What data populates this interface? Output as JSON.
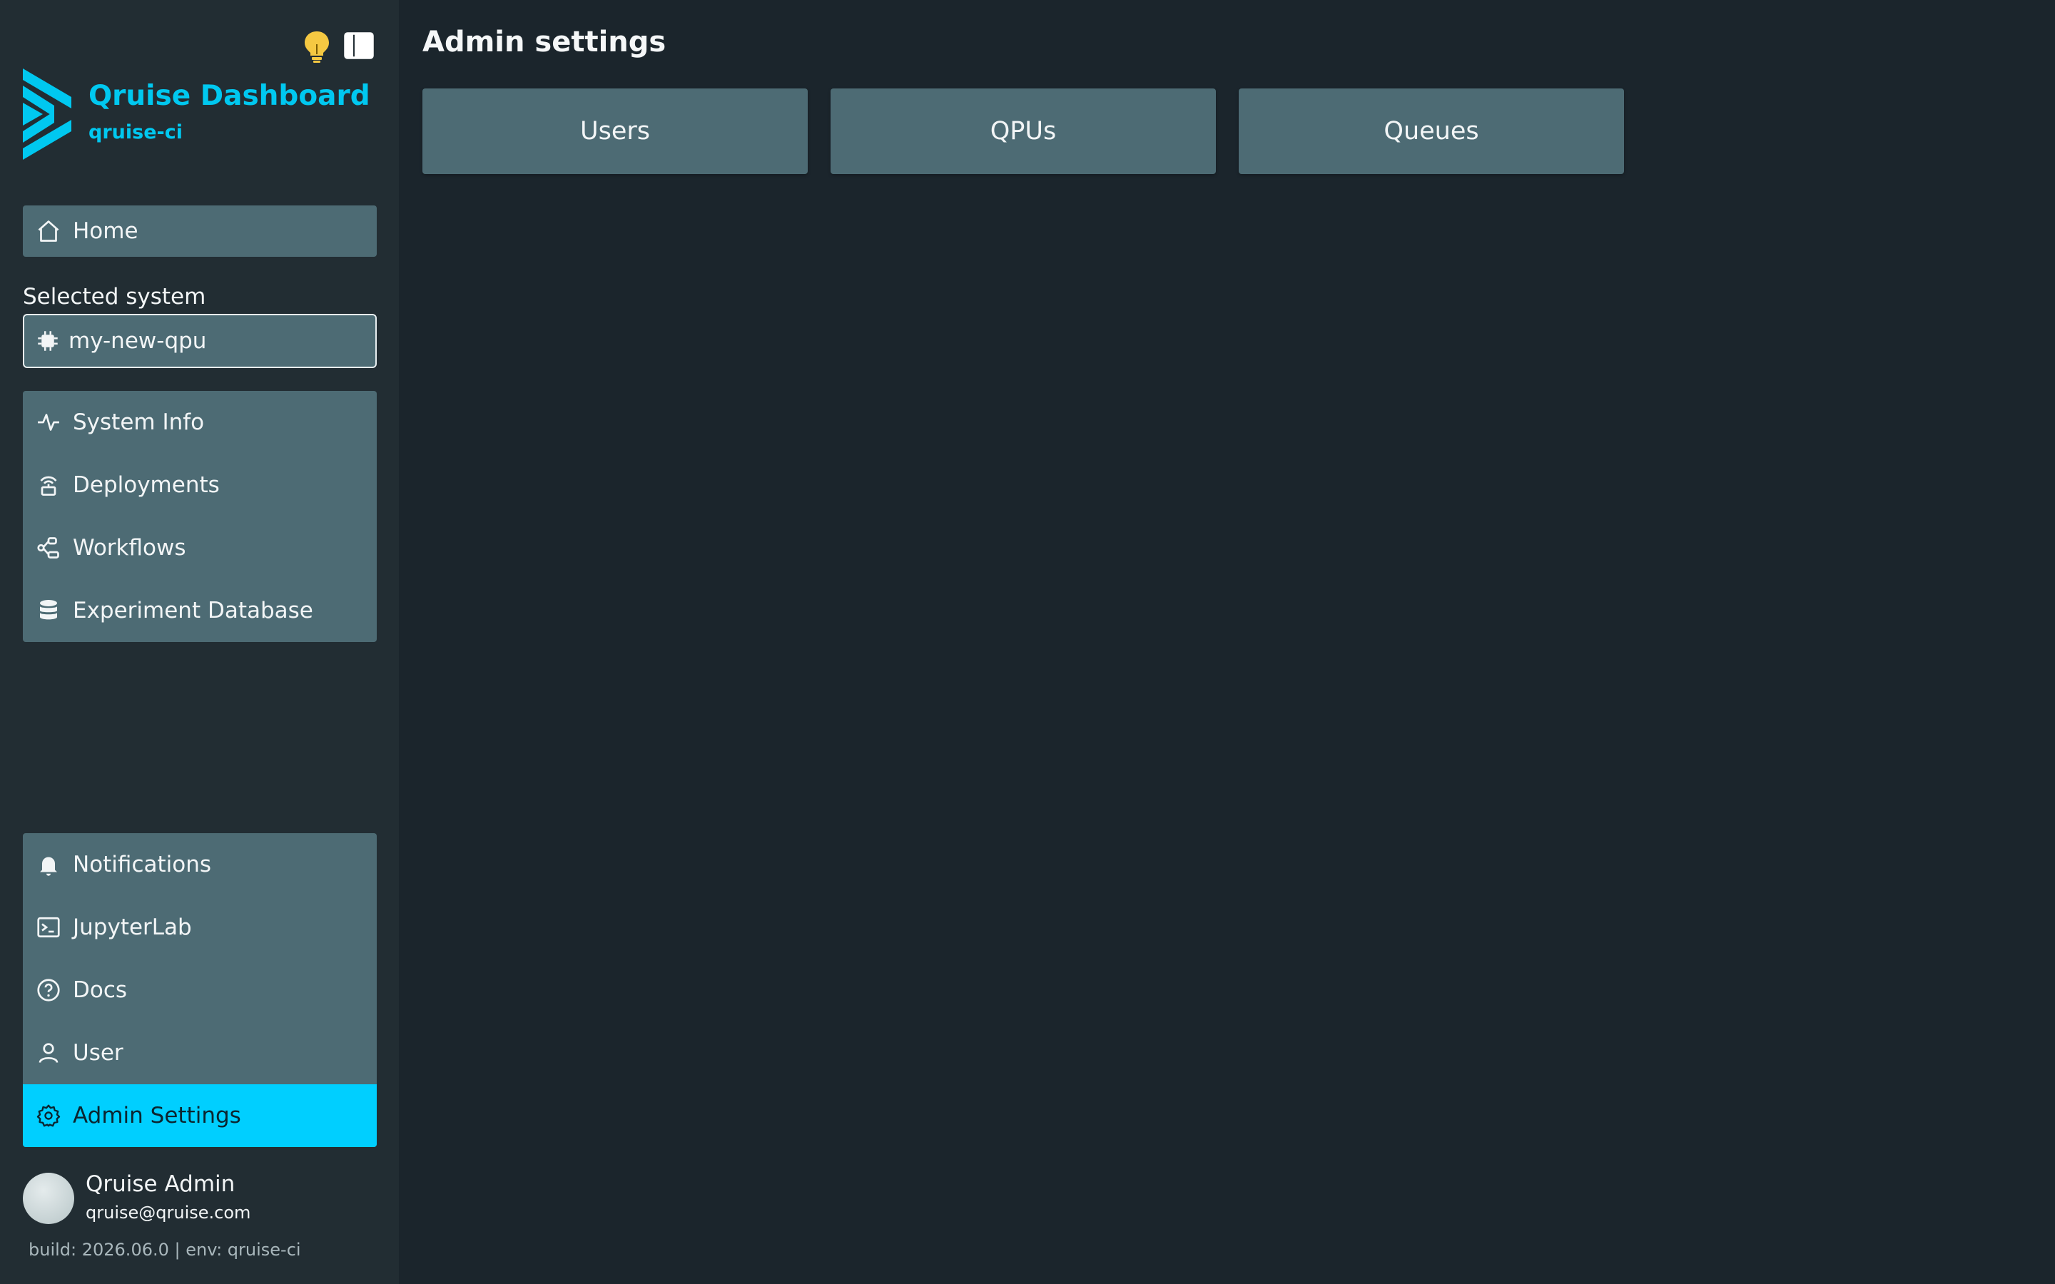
{
  "app": {
    "title": "Qruise Dashboard",
    "subtitle": "qruise-ci"
  },
  "colors": {
    "accent": "#00c8f0",
    "active_item": "#00cfff",
    "panel": "#4d6b74",
    "sidebar_bg": "#222d33",
    "main_bg": "#1b252c",
    "bulb": "#f5c842"
  },
  "nav": {
    "home": {
      "label": "Home",
      "icon": "home-icon"
    },
    "selected_system_label": "Selected system",
    "selected_system": {
      "value": "my-new-qpu",
      "icon": "chip-icon"
    },
    "system_items": [
      {
        "label": "System Info",
        "icon": "activity-icon"
      },
      {
        "label": "Deployments",
        "icon": "deployment-icon"
      },
      {
        "label": "Workflows",
        "icon": "workflow-icon"
      },
      {
        "label": "Experiment Database",
        "icon": "database-icon"
      }
    ],
    "bottom_items": [
      {
        "label": "Notifications",
        "icon": "bell-icon"
      },
      {
        "label": "JupyterLab",
        "icon": "terminal-icon"
      },
      {
        "label": "Docs",
        "icon": "help-circle-icon"
      },
      {
        "label": "User",
        "icon": "user-icon"
      },
      {
        "label": "Admin Settings",
        "icon": "gear-icon",
        "active": true
      }
    ]
  },
  "user": {
    "name": "Qruise Admin",
    "email": "qruise@qruise.com"
  },
  "footer": {
    "build": "build: 2026.06.0 | env: qruise-ci"
  },
  "main": {
    "title": "Admin settings",
    "buttons": [
      "Users",
      "QPUs",
      "Queues"
    ]
  }
}
